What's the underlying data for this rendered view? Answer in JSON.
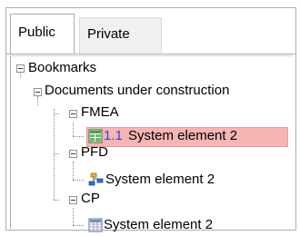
{
  "tabs": [
    {
      "label": "Public"
    },
    {
      "label": "Private"
    }
  ],
  "tree": {
    "root": "Bookmarks",
    "folder": "Documents under construction",
    "groups": [
      {
        "name": "FMEA",
        "child_prefix": "1.1",
        "child_label": "System element 2",
        "icon": "fmea-grid-icon",
        "selected": true
      },
      {
        "name": "PFD",
        "child_label": "System element 2",
        "icon": "process-flow-icon"
      },
      {
        "name": "CP",
        "child_label": "System element 2",
        "icon": "control-plan-icon"
      }
    ]
  },
  "colors": {
    "selection": "#f6b4b4",
    "prefix_text": "#1f4fd6"
  }
}
